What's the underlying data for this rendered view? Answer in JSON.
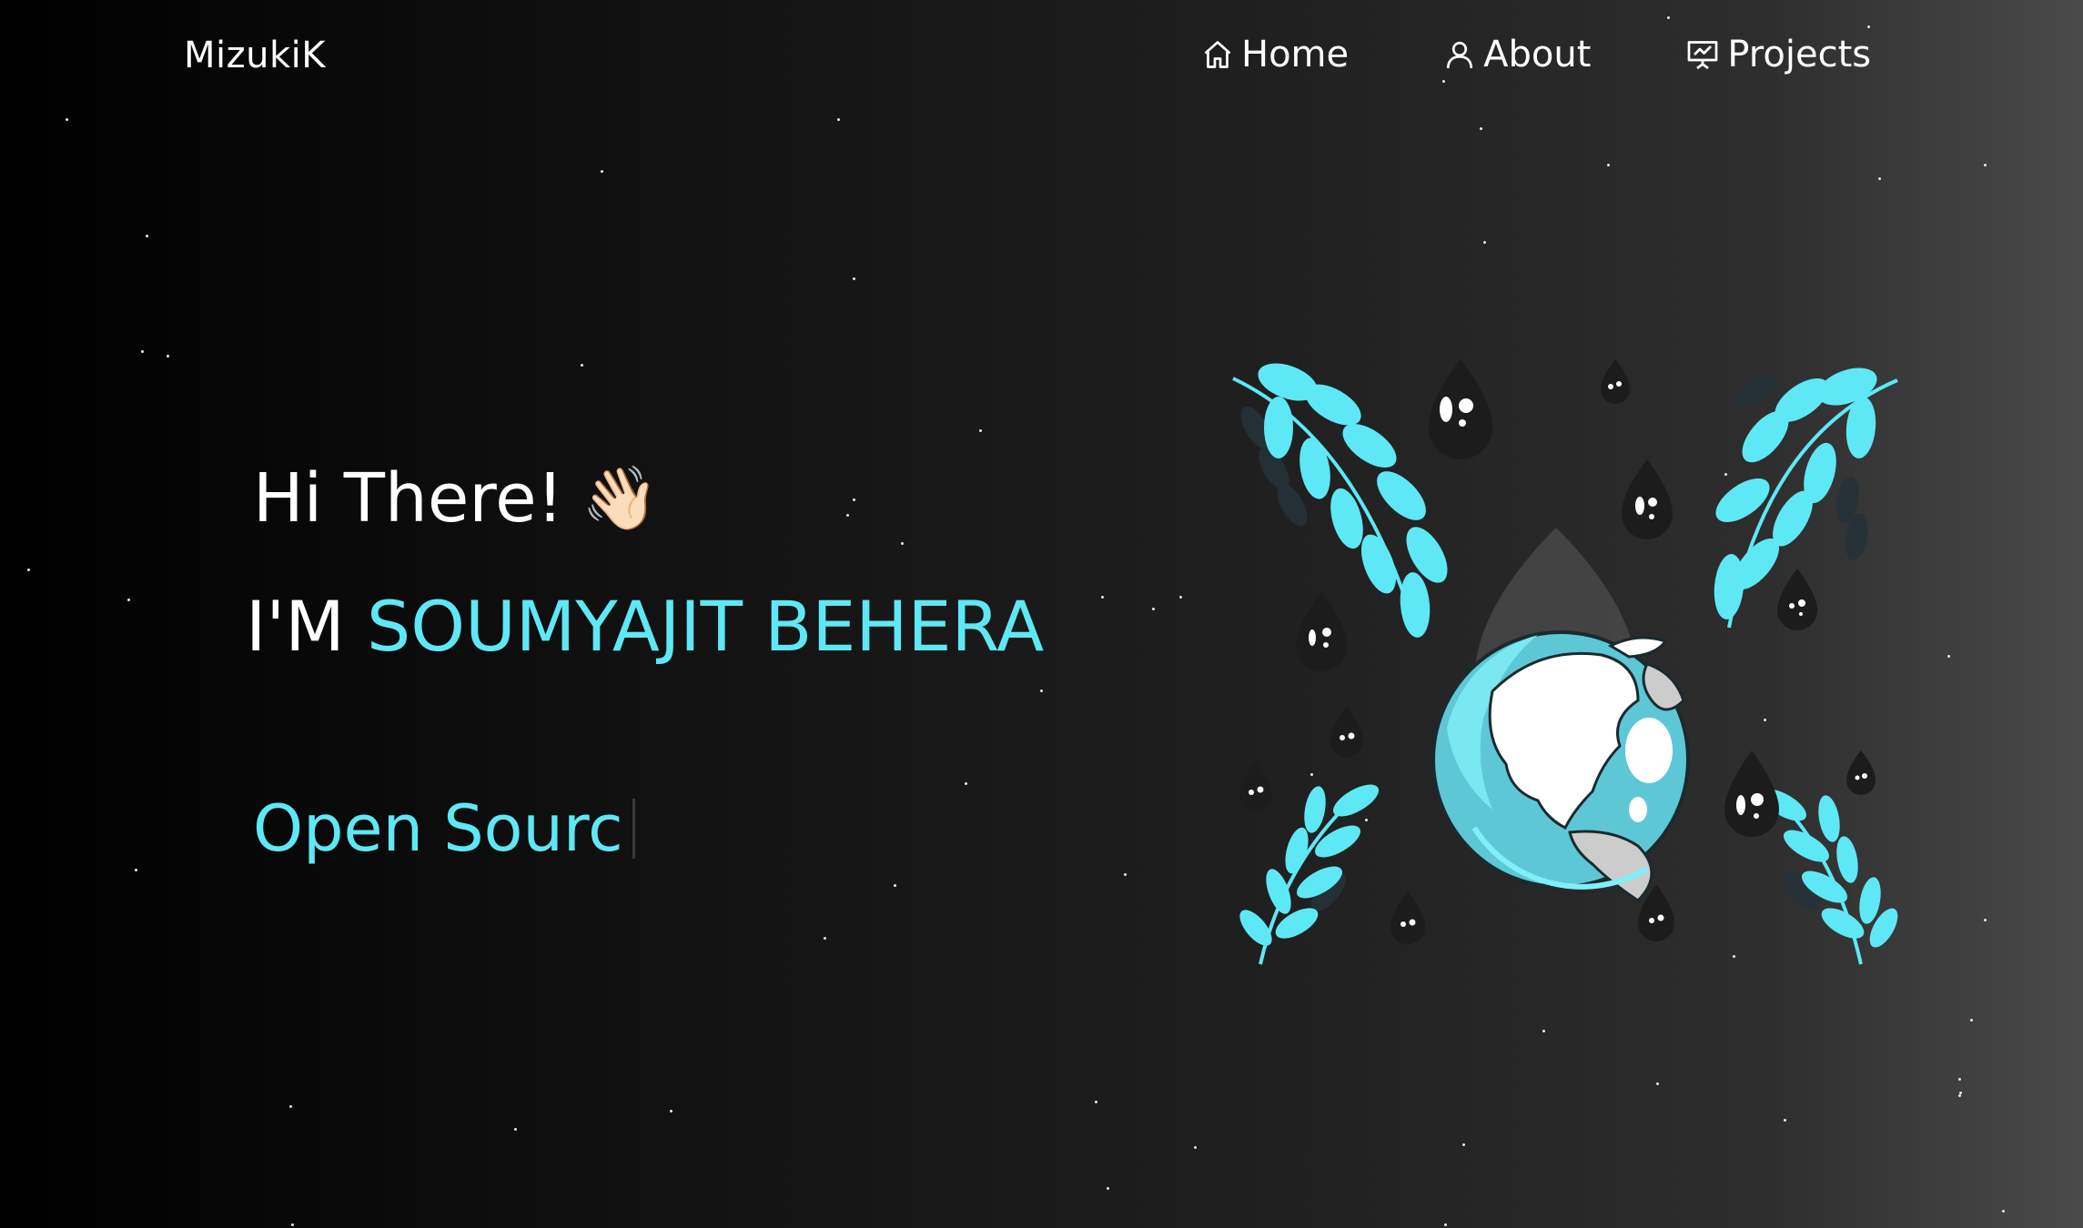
{
  "nav": {
    "brand": "MizukiK",
    "items": [
      {
        "label": "Home",
        "icon": "home-icon"
      },
      {
        "label": "About",
        "icon": "user-icon"
      },
      {
        "label": "Projects",
        "icon": "presentation-chart-icon"
      }
    ]
  },
  "hero": {
    "greeting": "Hi There!",
    "wave_emoji": "👋🏻",
    "intro_prefix": "I'M ",
    "name": "SOUMYAJIT BEHERA",
    "typewriter_text": "Open Sourc"
  },
  "illustration": {
    "subject": "earth-globe-with-leaves-and-droplets"
  },
  "colors": {
    "accent": "#5ee8f6",
    "text": "#ffffff",
    "background_start": "#000000",
    "background_end": "#4a4a4a"
  }
}
